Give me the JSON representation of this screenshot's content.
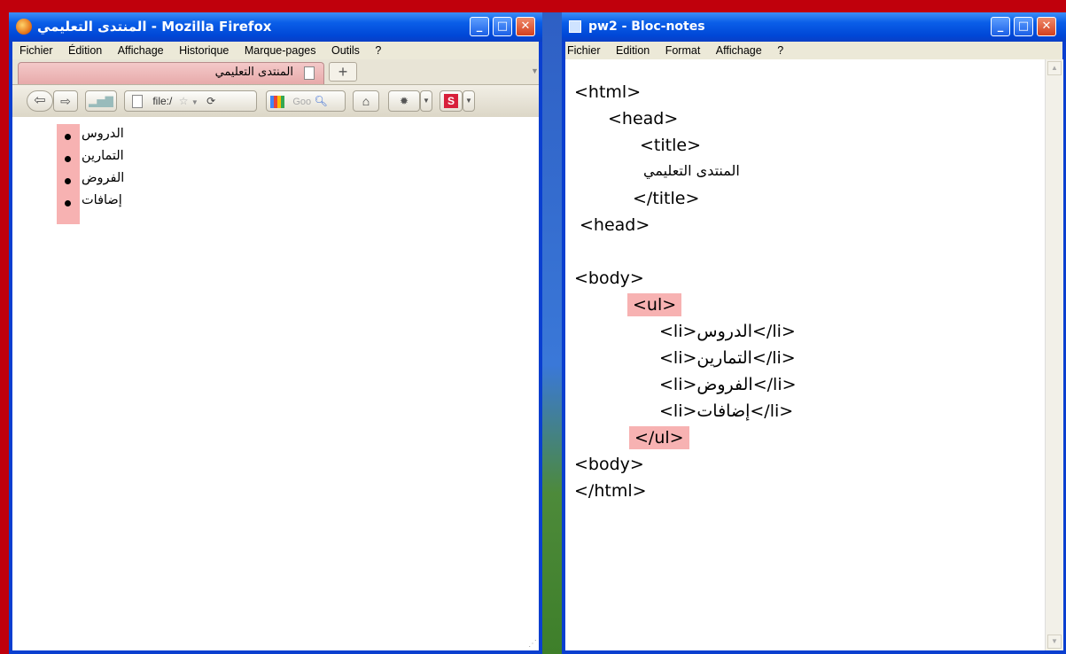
{
  "firefox": {
    "title": "المنتدى التعليمي - Mozilla Firefox",
    "menu": [
      "Fichier",
      "Édition",
      "Affichage",
      "Historique",
      "Marque-pages",
      "Outils",
      "?"
    ],
    "tab_title": "المنتدى التعليمي",
    "new_tab": "+",
    "url": "file:/",
    "search_placeholder": "Goo",
    "list_items": [
      "الدروس",
      "التمارين",
      "الفروض",
      "إضافات"
    ]
  },
  "notepad": {
    "title": "pw2 - Bloc-notes",
    "menu": [
      "Fichier",
      "Edition",
      "Format",
      "Affichage",
      "?"
    ],
    "lines": {
      "l1": "<html>",
      "l2": "<head>",
      "l3": "<title>",
      "l4": "المنتدى التعليمي",
      "l5": "</title>",
      "l6": "<head>",
      "l7": "<body>",
      "l8": "<ul>",
      "l9": "<li>الدروس</li>",
      "l10": "<li>التمارين</li>",
      "l11": "<li>الفروض</li>",
      "l12": "<li>إضافات</li>",
      "l13": "</ul>",
      "l14": "<body>",
      "l15": "</html>"
    }
  },
  "colors": {
    "highlight": "#f7b2b2",
    "title_bar": "#0a5ee8",
    "frame": "#c0000c"
  }
}
